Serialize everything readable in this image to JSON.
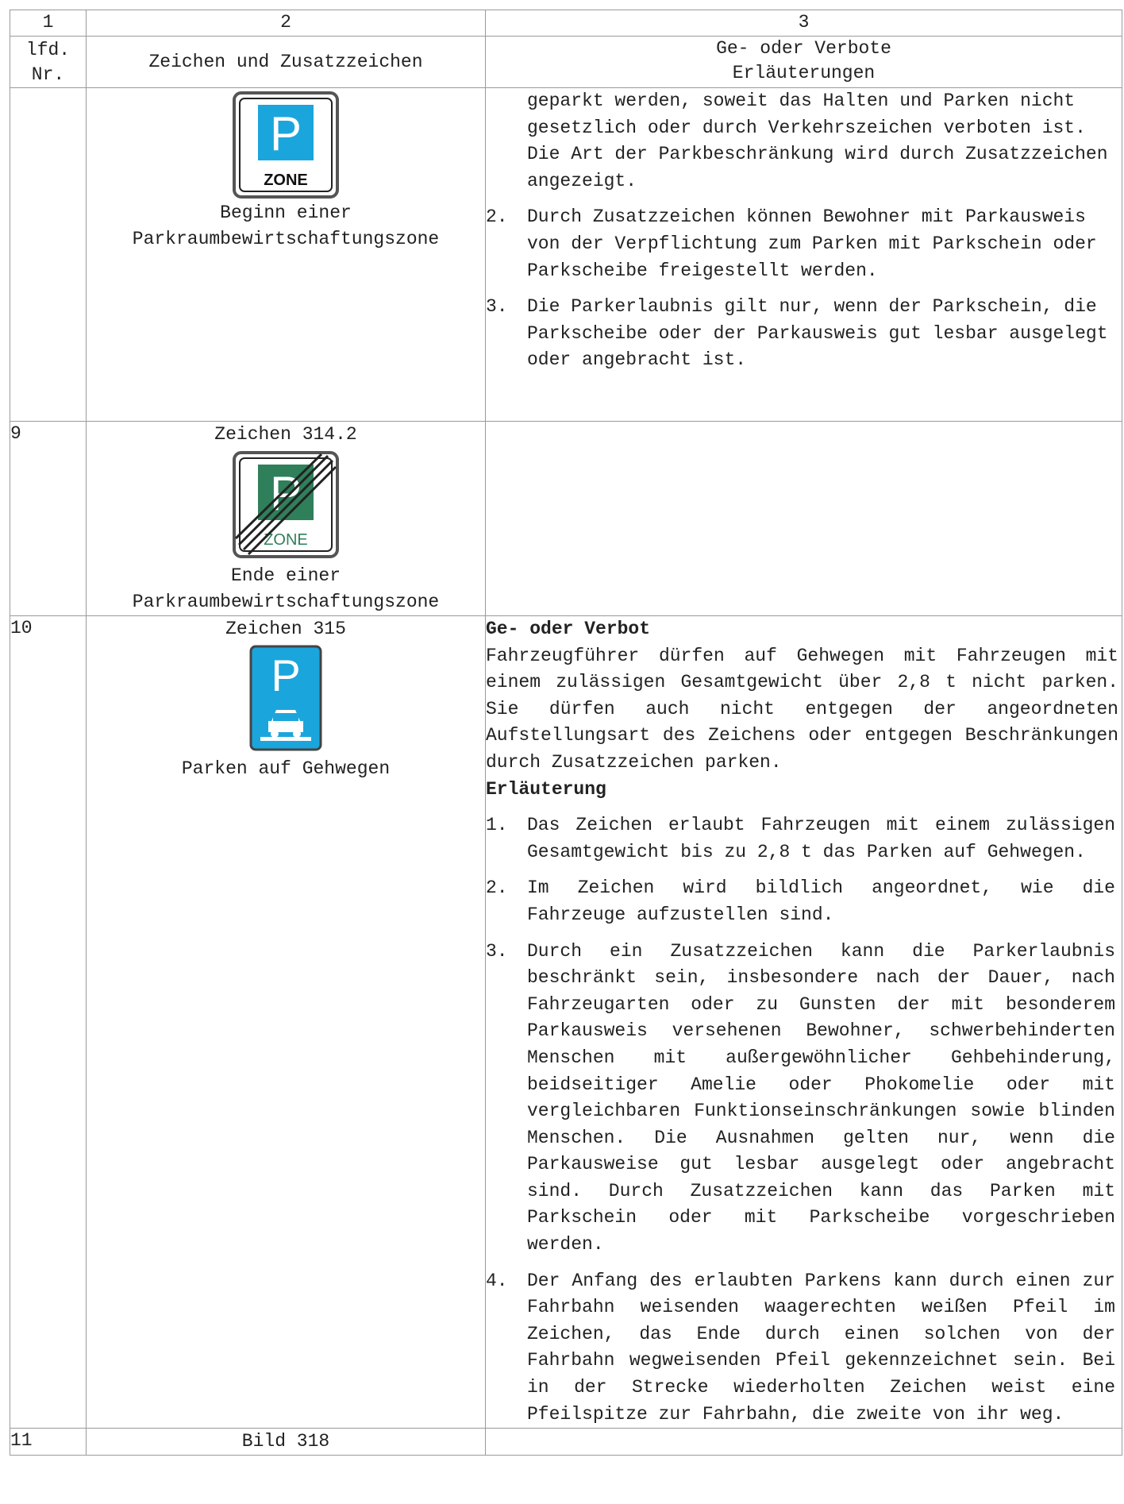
{
  "header": {
    "col1_number": "1",
    "col2_number": "2",
    "col3_number": "3",
    "col1_title": "lfd. Nr.",
    "col2_title": "Zeichen und Zusatzzeichen",
    "col3_title_line1": "Ge- oder Verbote",
    "col3_title_line2": "Erläuterungen"
  },
  "row8": {
    "number": "",
    "sign_icon": "parking-zone-sign",
    "sign_text": "ZONE",
    "caption": "Beginn einer Parkraumbewirtschaftungszone",
    "continuation": "geparkt werden, soweit das Halten und Parken nicht gesetzlich oder durch Verkehrszeichen verboten ist. Die Art der Parkbeschränkung wird durch Zusatzzeichen angezeigt.",
    "items": [
      {
        "num": "2.",
        "text": "Durch Zusatzzeichen können Bewohner mit Parkausweis von der Verpflichtung zum Parken mit Parkschein oder Parkscheibe freigestellt werden."
      },
      {
        "num": "3.",
        "text": "Die Parkerlaubnis gilt nur, wenn der Parkschein, die Parkscheibe oder der Parkausweis gut lesbar ausgelegt oder angebracht ist."
      }
    ]
  },
  "row9": {
    "number": "9",
    "sign_label": "Zeichen 314.2",
    "sign_icon": "end-parking-zone-sign",
    "sign_text": "ZONE",
    "caption": "Ende einer Parkraumbewirtschaftungszone"
  },
  "row10": {
    "number": "10",
    "sign_label": "Zeichen 315",
    "sign_icon": "sidewalk-parking-sign",
    "caption": "Parken auf Gehwegen",
    "heading1": "Ge- oder Verbot",
    "rule": "Fahrzeugführer dürfen auf Gehwegen mit Fahrzeugen mit einem zulässigen Gesamtgewicht über 2,8 t nicht parken. Sie dürfen auch nicht entgegen der angeordneten Aufstellungsart des Zeichens oder entgegen Beschränkungen durch Zusatzzeichen parken.",
    "heading2": "Erläuterung",
    "items": [
      {
        "num": "1.",
        "text": "Das Zeichen erlaubt Fahrzeugen mit einem zulässigen Gesamtgewicht bis zu 2,8 t das Parken auf Gehwegen."
      },
      {
        "num": "2.",
        "text": "Im Zeichen wird bildlich angeordnet, wie die Fahrzeuge aufzustellen sind."
      },
      {
        "num": "3.",
        "text": "Durch ein Zusatzzeichen kann die Parkerlaubnis beschränkt sein, insbesondere nach der Dauer, nach Fahrzeugarten oder zu Gunsten der mit besonderem Parkausweis versehenen Bewohner, schwerbehinderten Menschen mit außergewöhnlicher Gehbehinderung, beidseitiger Amelie oder Phokomelie oder mit vergleichbaren Funktionseinschränkungen sowie blinden Menschen. Die Ausnahmen gelten nur, wenn die Parkausweise gut lesbar ausgelegt oder angebracht sind. Durch Zusatzzeichen kann das Parken mit Parkschein oder mit Parkscheibe vorgeschrieben werden."
      },
      {
        "num": "4.",
        "text": "Der Anfang des erlaubten Parkens kann durch einen zur Fahrbahn weisenden waagerechten weißen Pfeil im Zeichen, das Ende durch einen solchen von der Fahrbahn wegweisenden Pfeil gekennzeichnet sein. Bei in der Strecke wiederholten Zeichen weist eine Pfeilspitze zur Fahrbahn, die zweite von ihr weg."
      }
    ]
  },
  "row11": {
    "number": "11",
    "sign_label": "Bild 318"
  },
  "colors": {
    "sign_blue": "#1aa6dc",
    "sign_green": "#2f7f5a",
    "border": "#9a9a9a"
  }
}
